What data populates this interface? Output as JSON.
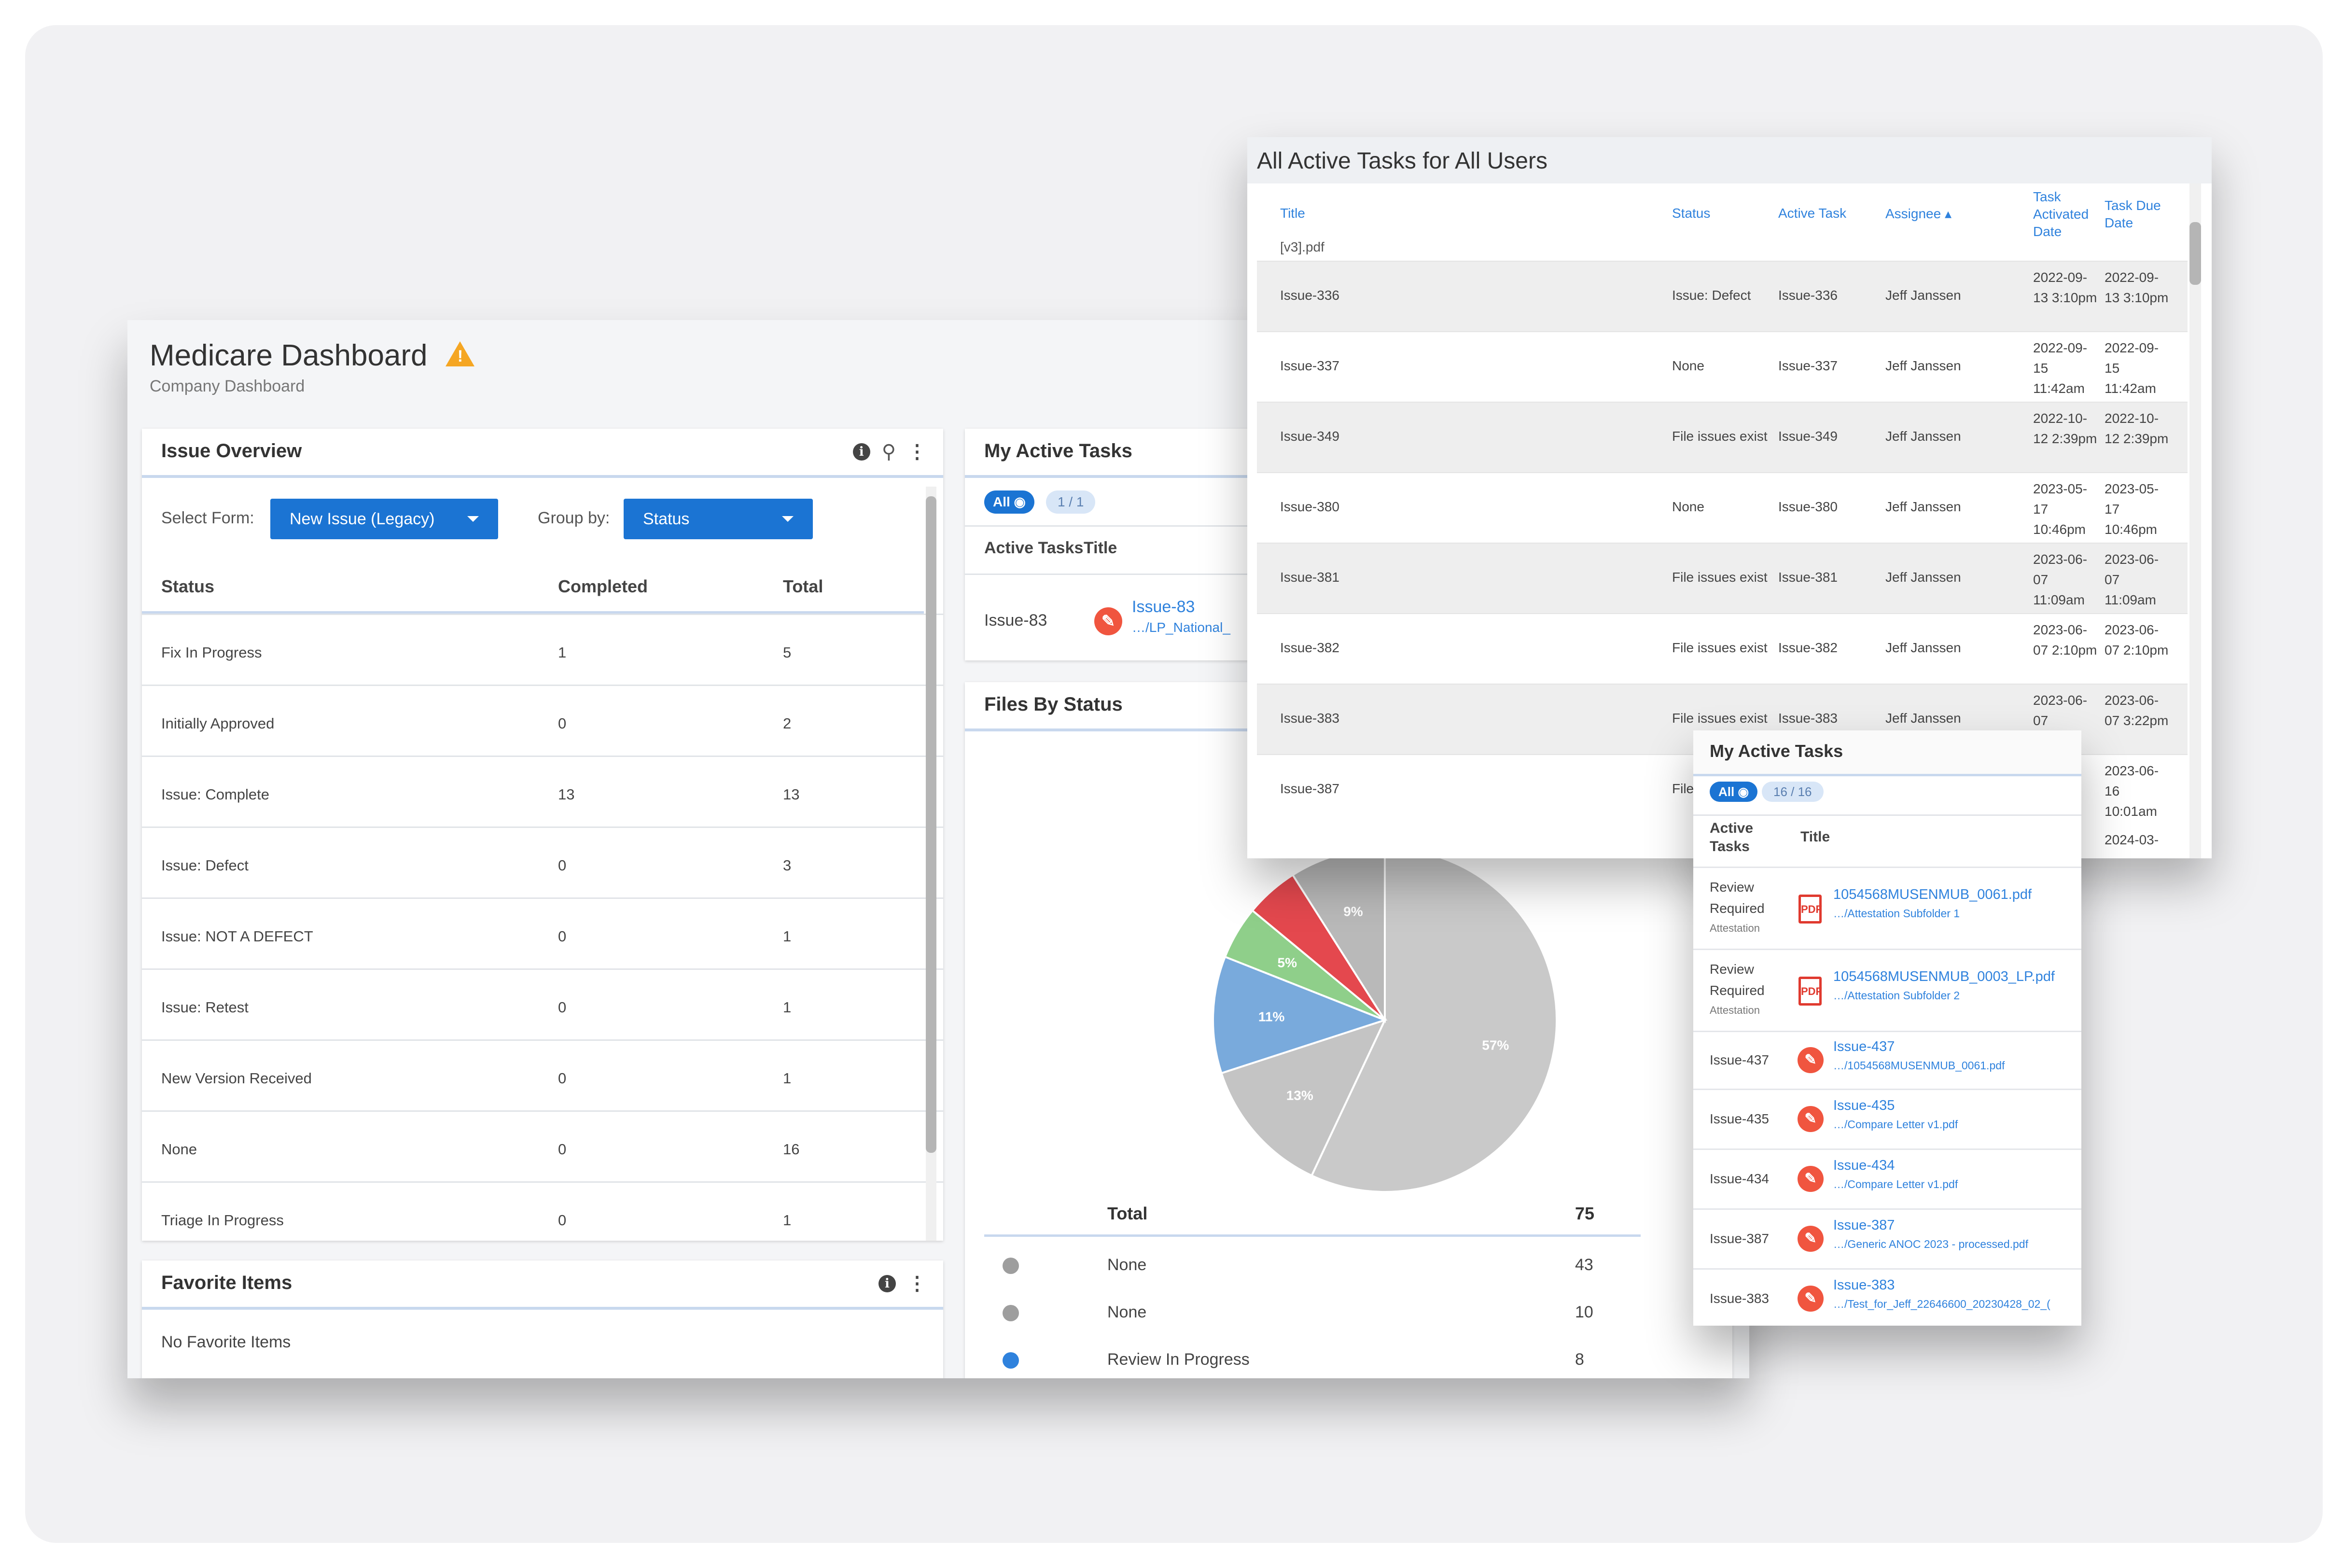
{
  "dashboard": {
    "title": "Medicare Dashboard",
    "warning_icon": "warning-icon",
    "warning_symbol": "!",
    "subtitle": "Company Dashboard"
  },
  "issue_overview": {
    "title": "Issue Overview",
    "icons": [
      "info-icon",
      "search-icon",
      "more-icon"
    ],
    "info_symbol": "i",
    "search_symbol": "⚲",
    "more_symbol": "⋮",
    "select_form_label": "Select Form:",
    "select_form_value": "New Issue (Legacy)",
    "group_by_label": "Group by:",
    "group_by_value": "Status",
    "columns": [
      "Status",
      "Completed",
      "Total"
    ],
    "rows": [
      {
        "status": "Fix In Progress",
        "completed": "1",
        "total": "5"
      },
      {
        "status": "Initially Approved",
        "completed": "0",
        "total": "2"
      },
      {
        "status": "Issue: Complete",
        "completed": "13",
        "total": "13"
      },
      {
        "status": "Issue: Defect",
        "completed": "0",
        "total": "3"
      },
      {
        "status": "Issue: NOT A DEFECT",
        "completed": "0",
        "total": "1"
      },
      {
        "status": "Issue: Retest",
        "completed": "0",
        "total": "1"
      },
      {
        "status": "New Version Received",
        "completed": "0",
        "total": "1"
      },
      {
        "status": "None",
        "completed": "0",
        "total": "16"
      },
      {
        "status": "Triage In Progress",
        "completed": "0",
        "total": "1"
      }
    ]
  },
  "favorites": {
    "title": "Favorite Items",
    "empty_text": "No Favorite Items",
    "info_symbol": "i",
    "more_symbol": "⋮"
  },
  "my_active_tasks_small": {
    "title": "My Active Tasks",
    "filter_all": "All",
    "filter_count": "1 / 1",
    "columns": [
      "Active Tasks",
      "Title"
    ],
    "row": {
      "task": "Issue-83",
      "title": "Issue-83",
      "path": "…/LP_National_"
    }
  },
  "files_by_status": {
    "title": "Files By Status",
    "legend_header_label": "Total",
    "legend_header_value": "75",
    "legend": [
      {
        "color": "#9e9e9e",
        "label": "None",
        "value": "43"
      },
      {
        "color": "#9e9e9e",
        "label": "None",
        "value": "10"
      },
      {
        "color": "#2f82dd",
        "label": "Review In Progress",
        "value": "8"
      }
    ]
  },
  "chart_data": {
    "type": "pie",
    "title": "",
    "slices": [
      {
        "label": "57%",
        "value": 57,
        "color": "#c9c9c9"
      },
      {
        "label": "13%",
        "value": 13,
        "color": "#c4c4c4"
      },
      {
        "label": "11%",
        "value": 11,
        "color": "#79aadc"
      },
      {
        "label": "5%",
        "value": 5,
        "color": "#8fcf8a"
      },
      {
        "label": "",
        "value": 5,
        "color": "#e4484e"
      },
      {
        "label": "9%",
        "value": 9,
        "color": "#b9b9b9"
      }
    ]
  },
  "all_active_tasks": {
    "title": "All Active Tasks for All Users",
    "columns": [
      "Title",
      "Status",
      "Active Task",
      "Assignee ▴",
      "Task Activated Date",
      "Task Due Date"
    ],
    "partial_row": "[v3].pdf",
    "rows": [
      {
        "title": "Issue-336",
        "status": "Issue: Defect",
        "task": "Issue-336",
        "assignee": "Jeff Janssen",
        "activated": "2022-09-13 3:10pm",
        "due": "2022-09-13 3:10pm"
      },
      {
        "title": "Issue-337",
        "status": "None",
        "task": "Issue-337",
        "assignee": "Jeff Janssen",
        "activated": "2022-09-15 11:42am",
        "due": "2022-09-15 11:42am"
      },
      {
        "title": "Issue-349",
        "status": "File issues exist",
        "task": "Issue-349",
        "assignee": "Jeff Janssen",
        "activated": "2022-10-12 2:39pm",
        "due": "2022-10-12 2:39pm"
      },
      {
        "title": "Issue-380",
        "status": "None",
        "task": "Issue-380",
        "assignee": "Jeff Janssen",
        "activated": "2023-05-17 10:46pm",
        "due": "2023-05-17 10:46pm"
      },
      {
        "title": "Issue-381",
        "status": "File issues exist",
        "task": "Issue-381",
        "assignee": "Jeff Janssen",
        "activated": "2023-06-07 11:09am",
        "due": "2023-06-07 11:09am"
      },
      {
        "title": "Issue-382",
        "status": "File issues exist",
        "task": "Issue-382",
        "assignee": "Jeff Janssen",
        "activated": "2023-06-07 2:10pm",
        "due": "2023-06-07 2:10pm"
      },
      {
        "title": "Issue-383",
        "status": "File issues exist",
        "task": "Issue-383",
        "assignee": "Jeff Janssen",
        "activated": "2023-06-07",
        "due": "2023-06-07 3:22pm"
      },
      {
        "title": "Issue-387",
        "status": "File",
        "task": "",
        "assignee": "",
        "activated": "",
        "due": "2023-06-16 10:01am"
      }
    ],
    "last_partial": "2024-03-"
  },
  "my_active_tasks_large": {
    "title": "My Active Tasks",
    "filter_all": "All",
    "filter_count": "16 / 16",
    "columns": [
      "Active Tasks",
      "Title"
    ],
    "rows": [
      {
        "task": "Review Required",
        "sub": "Attestation",
        "icon": "pdf-icon",
        "title": "1054568MUSENMUB_0061.pdf",
        "path": "…/Attestation Subfolder 1"
      },
      {
        "task": "Review Required",
        "sub": "Attestation",
        "icon": "pdf-icon",
        "title": "1054568MUSENMUB_0003_LP.pdf",
        "path": "…/Attestation Subfolder 2"
      },
      {
        "task": "Issue-437",
        "sub": "",
        "icon": "issue-icon",
        "title": "Issue-437",
        "path": "…/1054568MUSENMUB_0061.pdf"
      },
      {
        "task": "Issue-435",
        "sub": "",
        "icon": "issue-icon",
        "title": "Issue-435",
        "path": "…/Compare Letter v1.pdf"
      },
      {
        "task": "Issue-434",
        "sub": "",
        "icon": "issue-icon",
        "title": "Issue-434",
        "path": "…/Compare Letter v1.pdf"
      },
      {
        "task": "Issue-387",
        "sub": "",
        "icon": "issue-icon",
        "title": "Issue-387",
        "path": "…/Generic ANOC 2023 - processed.pdf"
      },
      {
        "task": "Issue-383",
        "sub": "",
        "icon": "issue-icon",
        "title": "Issue-383",
        "path": "…/Test_for_Jeff_22646600_20230428_02_("
      }
    ]
  }
}
